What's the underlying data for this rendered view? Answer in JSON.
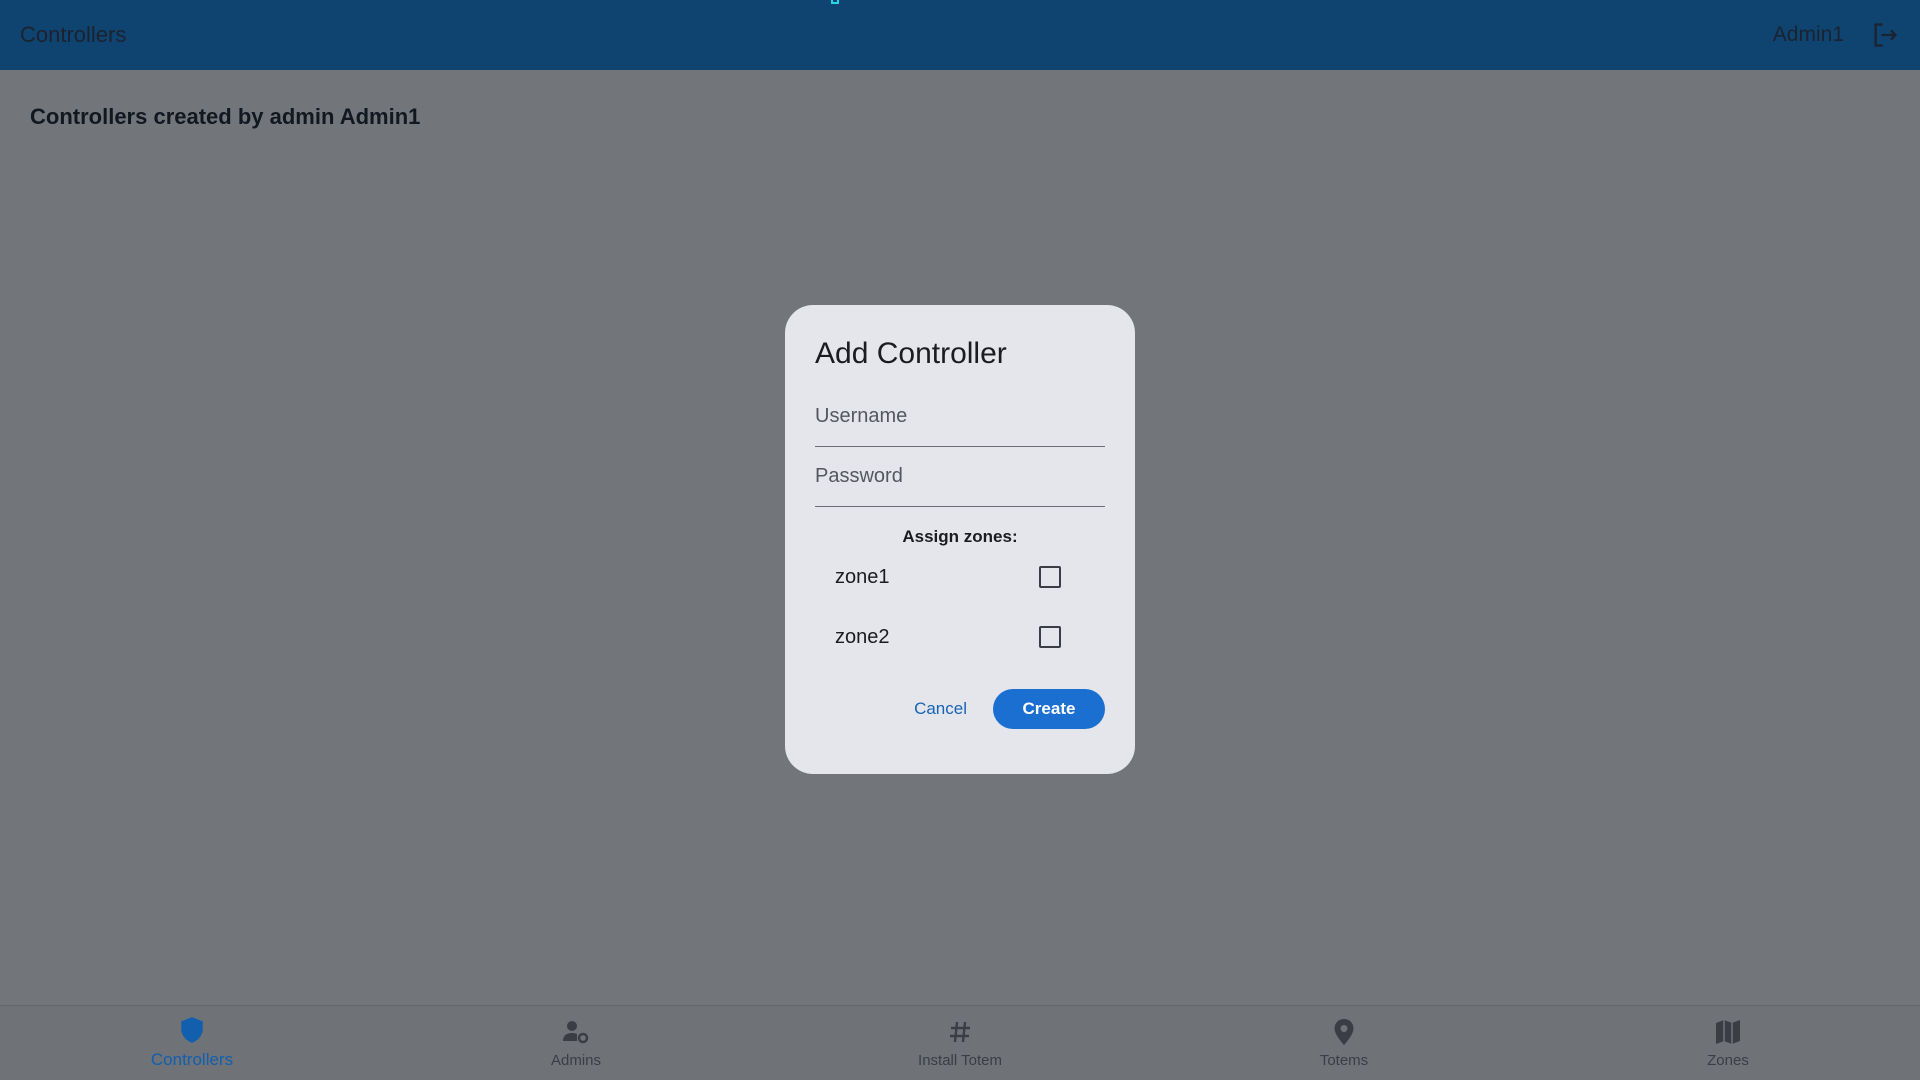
{
  "app_bar": {
    "title": "Controllers",
    "user_name": "Admin1"
  },
  "page": {
    "heading": "Controllers created by admin Admin1"
  },
  "dialog": {
    "title": "Add Controller",
    "username_placeholder": "Username",
    "password_placeholder": "Password",
    "assign_label": "Assign zones:",
    "zones": [
      {
        "label": "zone1"
      },
      {
        "label": "zone2"
      }
    ],
    "cancel_label": "Cancel",
    "create_label": "Create"
  },
  "bottom_nav": {
    "items": [
      {
        "label": "Controllers",
        "icon": "shield-icon"
      },
      {
        "label": "Admins",
        "icon": "admin-settings-icon"
      },
      {
        "label": "Install Totem",
        "icon": "hashtag-icon"
      },
      {
        "label": "Totems",
        "icon": "location-pin-icon"
      },
      {
        "label": "Zones",
        "icon": "map-icon"
      }
    ]
  },
  "colors": {
    "app_bar": "#0f4470",
    "accent": "#1b6fd1",
    "scrim": "#72767a",
    "dialog": "#e5e6eb"
  }
}
